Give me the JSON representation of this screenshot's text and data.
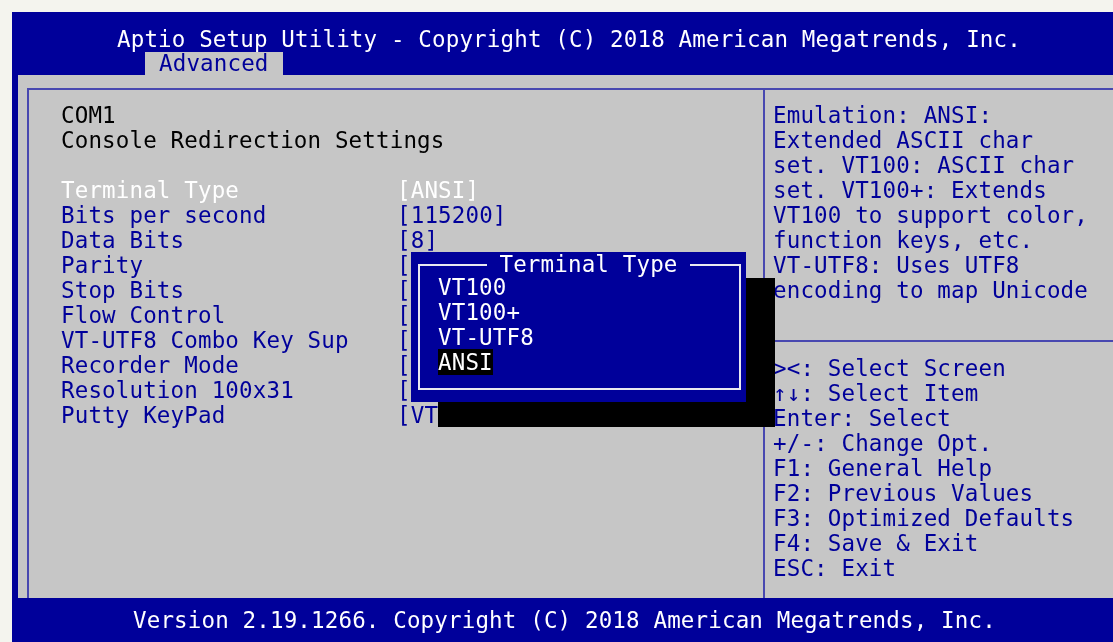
{
  "window": {
    "title": "Aptio Setup Utility - Copyright (C) 2018 American Megatrends, Inc."
  },
  "tabs": [
    {
      "label": "Advanced",
      "selected": true
    }
  ],
  "heading": [
    "COM1",
    "Console Redirection Settings"
  ],
  "settings": [
    {
      "label": "Terminal Type",
      "value": "[ANSI]",
      "selected": true
    },
    {
      "label": "Bits per second",
      "value": "[115200]",
      "selected": false
    },
    {
      "label": "Data Bits",
      "value": "[8]",
      "selected": false
    },
    {
      "label": "Parity",
      "value": "[",
      "selected": false
    },
    {
      "label": "Stop Bits",
      "value": "[",
      "selected": false
    },
    {
      "label": "Flow Control",
      "value": "[",
      "selected": false
    },
    {
      "label": "VT-UTF8 Combo Key Sup",
      "value": "[",
      "selected": false
    },
    {
      "label": "Recorder Mode",
      "value": "[",
      "selected": false
    },
    {
      "label": "Resolution 100x31",
      "value": "[",
      "selected": false
    },
    {
      "label": "Putty KeyPad",
      "value": "[VT",
      "selected": false
    }
  ],
  "popup": {
    "title": "Terminal Type",
    "options": [
      {
        "label": "VT100",
        "selected": false
      },
      {
        "label": "VT100+",
        "selected": false
      },
      {
        "label": "VT-UTF8",
        "selected": false
      },
      {
        "label": "ANSI",
        "selected": true
      }
    ]
  },
  "help": {
    "description": [
      "Emulation: ANSI:",
      "Extended ASCII char",
      "set. VT100: ASCII char",
      "set. VT100+: Extends",
      "VT100 to support color,",
      "function keys, etc.",
      "VT-UTF8: Uses UTF8",
      "encoding to map Unicode"
    ],
    "keys": [
      "><: Select Screen",
      "↑↓: Select Item",
      "Enter: Select",
      "+/-: Change Opt.",
      "F1: General Help",
      "F2: Previous Values",
      "F3: Optimized Defaults",
      "F4: Save & Exit",
      "ESC: Exit"
    ]
  },
  "status_bar": "Version 2.19.1266. Copyright (C) 2018 American Megatrends, Inc."
}
